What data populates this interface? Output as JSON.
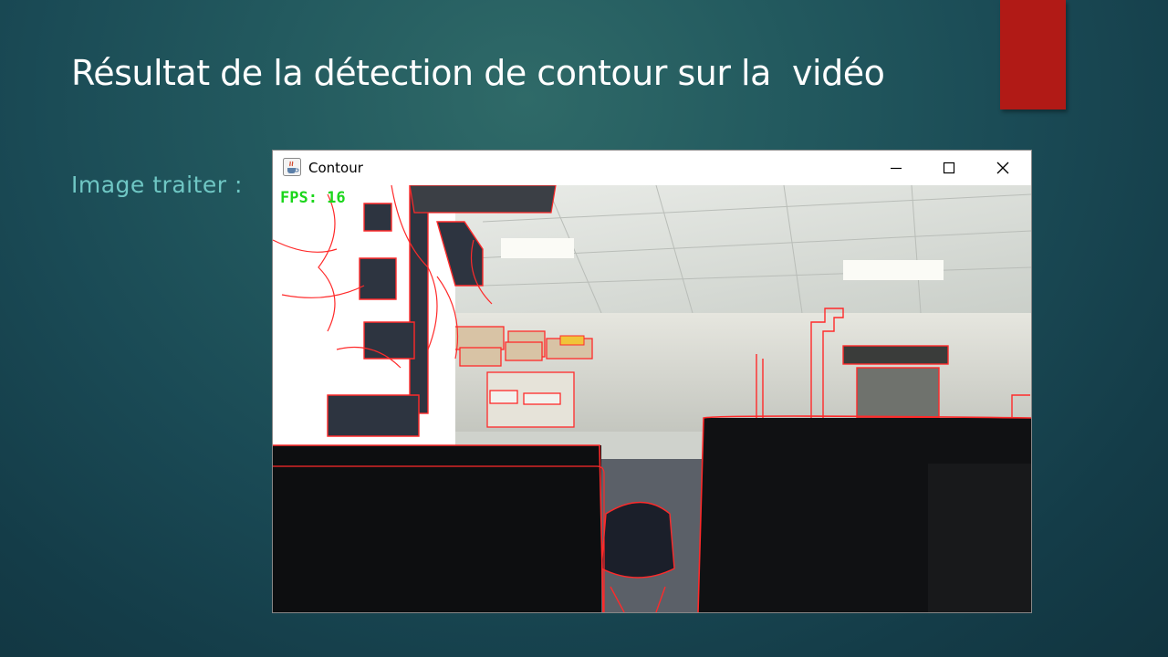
{
  "slide": {
    "title": "Résultat de la détection de contour sur la  vidéo",
    "bullet": "Image traiter :",
    "colors": {
      "accent": "#b11a16",
      "title": "#ffffff",
      "bullet": "#6fc7c4"
    }
  },
  "window": {
    "title": "Contour",
    "icon": "java-coffee-icon",
    "controls": {
      "minimize": "minimize-icon",
      "maximize": "maximize-icon",
      "close": "close-icon"
    }
  },
  "video": {
    "overlay_text": "FPS: 16",
    "contour_color": "#ff2a2a",
    "overlay_color": "#1bd61b"
  }
}
